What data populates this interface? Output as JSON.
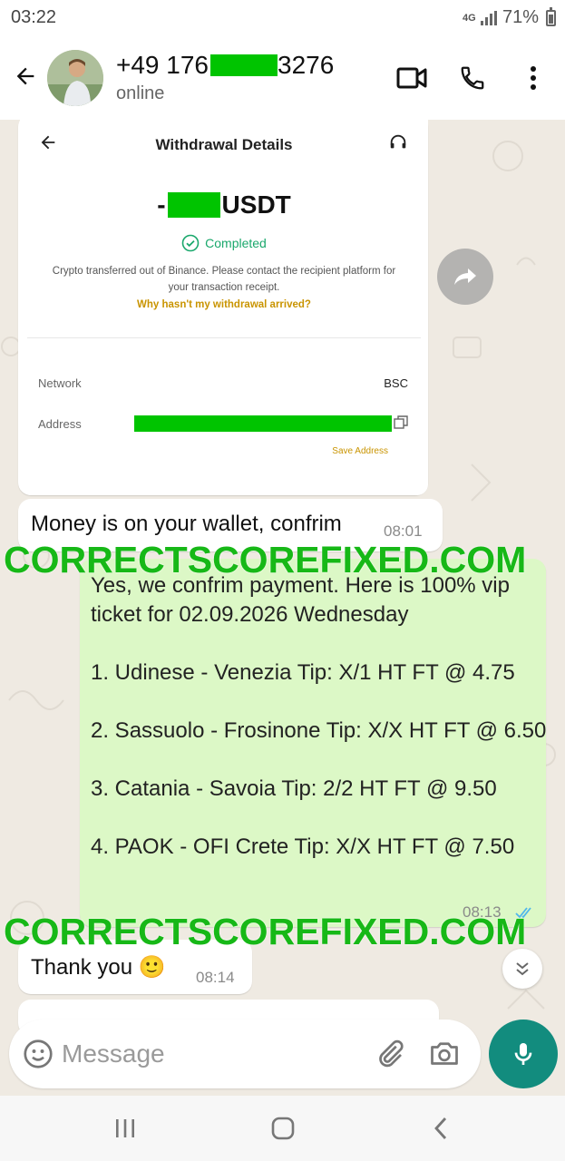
{
  "status_bar": {
    "time": "03:22",
    "network": "4G",
    "battery": "71%"
  },
  "header": {
    "name_prefix": "+49 176",
    "name_suffix": "3276",
    "status": "online"
  },
  "withdrawal_screenshot": {
    "title": "Withdrawal Details",
    "amount_prefix": "-",
    "currency": "USDT",
    "status": "Completed",
    "description": "Crypto transferred out of Binance. Please contact the recipient platform for your transaction receipt.",
    "help_link": "Why hasn't my withdrawal arrived?",
    "network_label": "Network",
    "network_value": "BSC",
    "address_label": "Address",
    "save_address": "Save Address"
  },
  "messages": [
    {
      "direction": "in",
      "text": "Money is on your wallet, confrim",
      "time": "08:01"
    },
    {
      "direction": "out",
      "text": "Yes, we confrim payment. Here is 100% vip ticket for 02.09.2026 Wednesday\n\n1. Udinese - Venezia Tip: X/1 HT FT @ 4.75\n\n2. Sassuolo - Frosinone Tip: X/X HT FT @ 6.50\n\n3. Catania - Savoia Tip: 2/2 HT FT @ 9.50\n\n4. PAOK - OFI Crete Tip: X/X HT FT @ 7.50",
      "time": "08:13"
    },
    {
      "direction": "in",
      "text": "Thank you 🙂",
      "time": "08:14"
    }
  ],
  "watermark": "CORRECTSCOREFIXED.COM",
  "input": {
    "placeholder": "Message"
  },
  "colors": {
    "accent": "#128c7e",
    "outgoing_bubble": "#dcf8c6",
    "watermark": "#17b817",
    "redaction": "#00c400"
  },
  "icons": [
    "back-arrow-icon",
    "video-call-icon",
    "phone-icon",
    "more-vert-icon",
    "forward-icon",
    "emoji-icon",
    "attach-icon",
    "camera-icon",
    "mic-icon",
    "chevron-double-down-icon"
  ]
}
